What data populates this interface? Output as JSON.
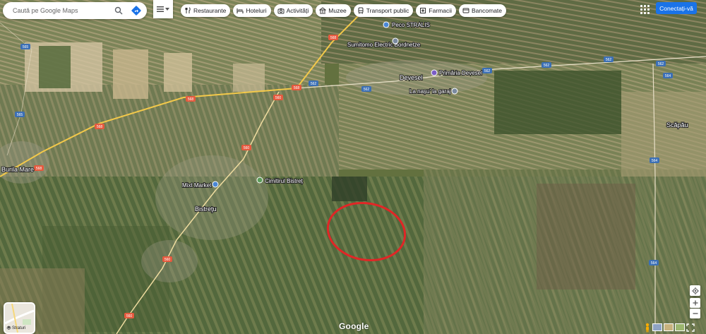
{
  "search": {
    "placeholder": "Caută pe Google Maps"
  },
  "chips": [
    {
      "label": "Restaurante",
      "icon": "restaurant-icon"
    },
    {
      "label": "Hoteluri",
      "icon": "hotel-icon"
    },
    {
      "label": "Activități",
      "icon": "camera-icon"
    },
    {
      "label": "Muzee",
      "icon": "museum-icon"
    },
    {
      "label": "Transport public",
      "icon": "transit-icon"
    },
    {
      "label": "Farmacii",
      "icon": "pharmacy-icon"
    },
    {
      "label": "Bancomate",
      "icon": "atm-icon"
    }
  ],
  "header": {
    "signin_label": "Conectați-vă"
  },
  "places": [
    {
      "label": "Burila Mare"
    },
    {
      "label": "Devesel"
    },
    {
      "label": "Bistreţu"
    },
    {
      "label": "Scăpău"
    },
    {
      "label": "Primăria Devesel"
    },
    {
      "label": "Mixt Market"
    },
    {
      "label": "Cimitirul Bistreț"
    },
    {
      "label": "Peco STRALIS"
    },
    {
      "label": "Sumitomo Electric Bordnetze"
    },
    {
      "label": "La nașu' la garaj"
    }
  ],
  "roads": [
    "565",
    "568",
    "560",
    "562",
    "564"
  ],
  "layers": {
    "label": "Straturi"
  },
  "brand": {
    "google_label": "Google"
  },
  "colors": {
    "road_yellow": "#f3c94a",
    "shield_blue": "#3b6fb5",
    "marker_red": "#e02626",
    "button_blue": "#1a73e8"
  }
}
